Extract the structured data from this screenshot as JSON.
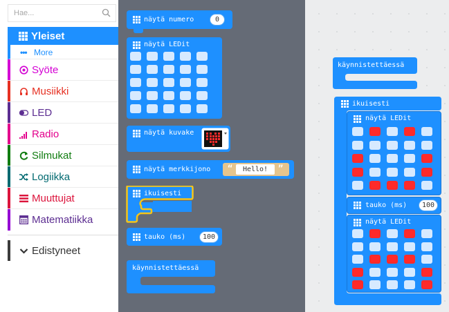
{
  "search": {
    "placeholder": "Hae..."
  },
  "categories": [
    {
      "label": "Yleiset",
      "color": "#1e90ff",
      "icon": "grid-icon"
    },
    {
      "label": "Syöte",
      "color": "#d400d4",
      "icon": "target-icon"
    },
    {
      "label": "Musiikki",
      "color": "#e63022",
      "icon": "headphones-icon"
    },
    {
      "label": "LED",
      "color": "#5c2d91",
      "icon": "toggle-icon"
    },
    {
      "label": "Radio",
      "color": "#e3008c",
      "icon": "signal-bars-icon"
    },
    {
      "label": "Silmukat",
      "color": "#107c10",
      "icon": "loop-arrow-icon"
    },
    {
      "label": "Logiikka",
      "color": "#006970",
      "icon": "shuffle-icon"
    },
    {
      "label": "Muuttujat",
      "color": "#dc143c",
      "icon": "lines-icon"
    },
    {
      "label": "Matematiikka",
      "color": "#9400d3",
      "icon": "calculator-icon"
    },
    {
      "label": "Edistyneet",
      "color": "#3c3c3c",
      "icon": "chevron-down-icon"
    }
  ],
  "more": {
    "label": "More"
  },
  "flyout": {
    "show_number": {
      "label": "näytä numero",
      "value": "0"
    },
    "show_leds": {
      "label": "näytä LEDit"
    },
    "show_icon": {
      "label": "näytä kuvake"
    },
    "show_string": {
      "label": "näytä merkkijono",
      "value": "Hello!",
      "quote_open": "“",
      "quote_close": "”"
    },
    "forever": {
      "label": "ikuisesti"
    },
    "pause": {
      "label": "tauko (ms)",
      "value": "100"
    },
    "on_start": {
      "label": "käynnistettäessä"
    }
  },
  "workspace": {
    "on_start": {
      "label": "käynnistettäessä"
    },
    "forever": {
      "label": "ikuisesti"
    },
    "leds1": {
      "label": "näytä LEDit",
      "grid": [
        [
          0,
          1,
          0,
          1,
          0
        ],
        [
          0,
          0,
          0,
          0,
          0
        ],
        [
          1,
          0,
          0,
          0,
          1
        ],
        [
          1,
          0,
          0,
          0,
          1
        ],
        [
          0,
          1,
          1,
          1,
          0
        ]
      ]
    },
    "pause": {
      "label": "tauko (ms)",
      "value": "100"
    },
    "leds2": {
      "label": "näytä LEDit",
      "grid": [
        [
          0,
          1,
          0,
          1,
          0
        ],
        [
          0,
          0,
          0,
          0,
          0
        ],
        [
          0,
          1,
          1,
          1,
          0
        ],
        [
          1,
          0,
          0,
          0,
          1
        ],
        [
          1,
          0,
          0,
          0,
          1
        ]
      ]
    }
  },
  "colors": {
    "basic": "#1e90ff",
    "flyout_bg": "#656b76",
    "led_on": "#ff2a2a",
    "led_off": "#d7eaff",
    "highlight": "#f5c518"
  }
}
